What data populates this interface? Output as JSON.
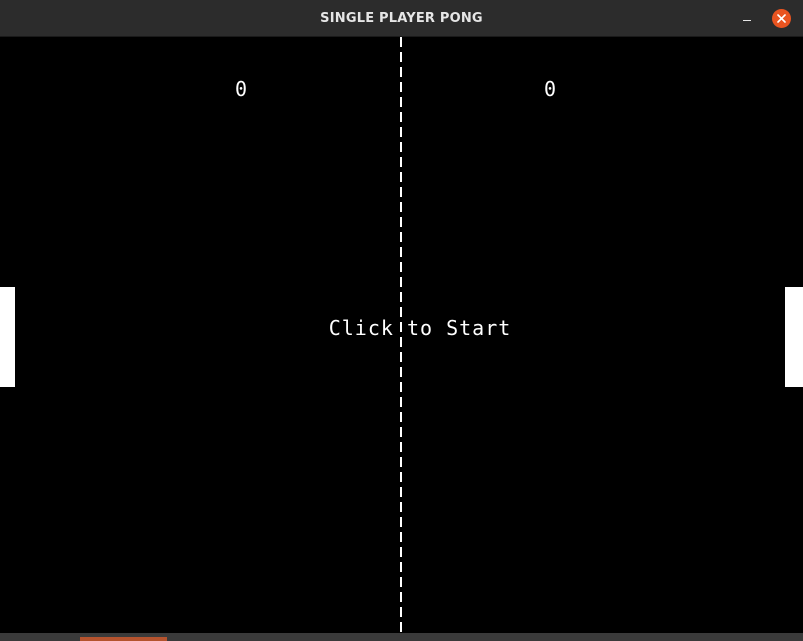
{
  "window": {
    "title": "SINGLE PLAYER PONG"
  },
  "game": {
    "score_left": "0",
    "score_right": "0",
    "start_message": "Click to Start"
  },
  "colors": {
    "background": "#000000",
    "foreground": "#ffffff",
    "titlebar": "#2c2c2c",
    "close_button": "#e95420"
  },
  "icons": {
    "minimize": "minimize-icon",
    "close": "close-icon"
  }
}
